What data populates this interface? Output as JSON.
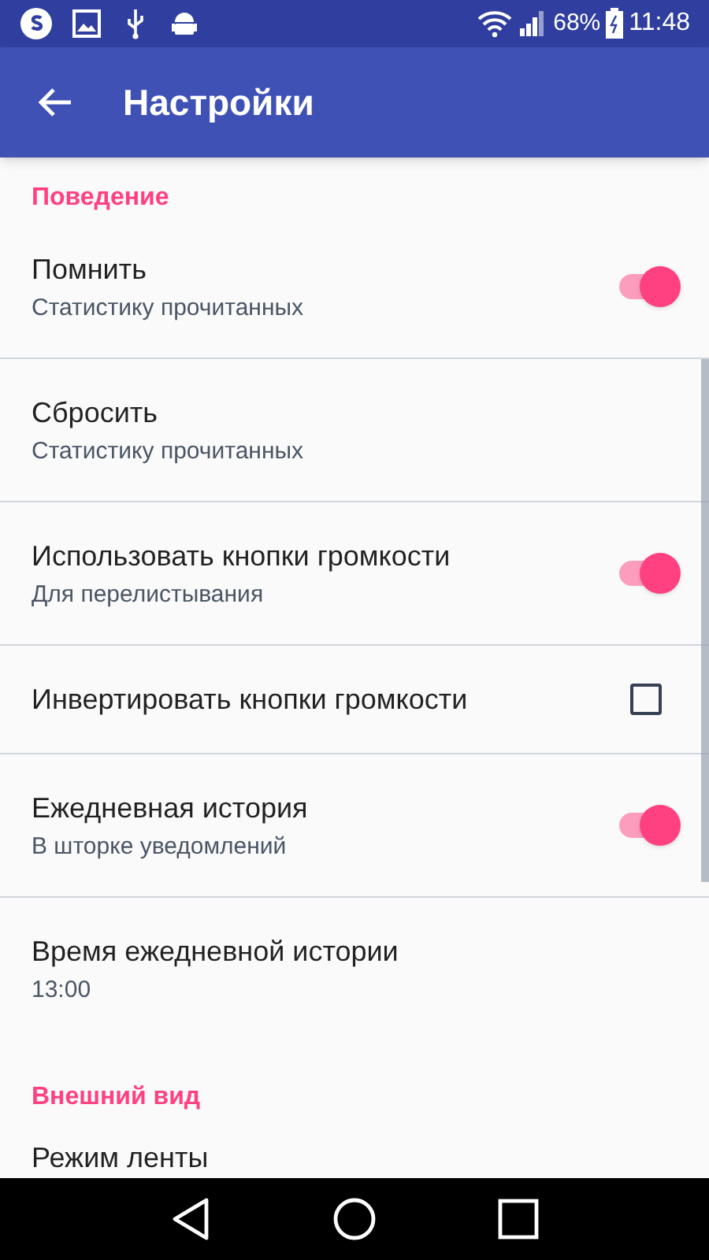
{
  "status_bar": {
    "battery": "68%",
    "time": "11:48"
  },
  "toolbar": {
    "title": "Настройки"
  },
  "sections": [
    {
      "header": "Поведение",
      "items": [
        {
          "kind": "switch",
          "title": "Помнить",
          "subtitle": "Статистику прочитанных",
          "on": true
        },
        {
          "kind": "plain",
          "title": "Сбросить",
          "subtitle": "Статистику прочитанных"
        },
        {
          "kind": "switch",
          "title": "Использовать кнопки громкости",
          "subtitle": "Для перелистывания",
          "on": true
        },
        {
          "kind": "checkbox",
          "title": "Инвертировать кнопки громкости",
          "checked": false
        },
        {
          "kind": "switch",
          "title": "Ежедневная история",
          "subtitle": "В шторке уведомлений",
          "on": true
        },
        {
          "kind": "plain",
          "title": "Время ежедневной истории",
          "subtitle": "13:00"
        }
      ]
    },
    {
      "header": "Внешний вид",
      "items": [
        {
          "kind": "plain",
          "title": "Режим ленты"
        }
      ]
    }
  ]
}
